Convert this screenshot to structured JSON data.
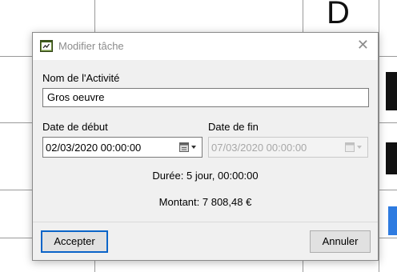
{
  "background": {
    "letter": "D"
  },
  "dialog": {
    "title": "Modifier tâche",
    "close_glyph": "✕",
    "activity_label": "Nom de l'Activité",
    "activity_value": "Gros oeuvre",
    "start_label": "Date de début",
    "start_value": "02/03/2020 00:00:00",
    "end_label": "Date de fin",
    "end_value": "07/03/2020 00:00:00",
    "duration": "Durée: 5 jour, 00:00:00",
    "amount": "Montant: 7 808,48 €",
    "accept_label": "Accepter",
    "cancel_label": "Annuler"
  },
  "colors": {
    "accent": "#0a64c8",
    "dialog_bg": "#f0f0f0",
    "titlebar_bg": "#ffffff",
    "disabled_text": "#a8a8a8"
  },
  "icons": {
    "title": "task-edit-icon",
    "close": "close-icon",
    "calendar": "calendar-dropdown-icon"
  }
}
